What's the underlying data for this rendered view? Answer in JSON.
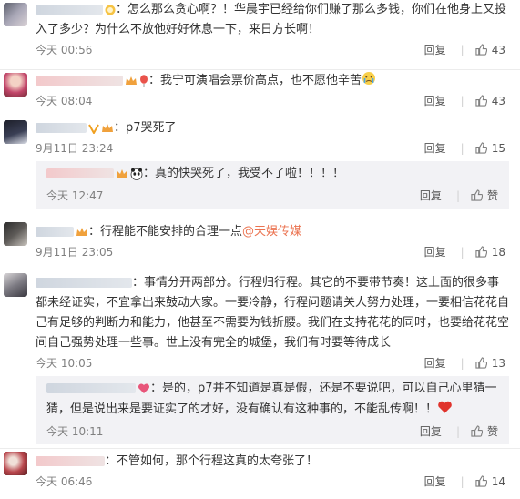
{
  "comments": [
    {
      "text": "：怎么那么贪心啊？！华晨宇已经给你们赚了那么多钱，你们在他身上又投入了多少？为什么不放他好好休息一下，来日方长啊！",
      "time": "今天 00:56",
      "reply": "回复",
      "likes": "43"
    },
    {
      "text": "：我宁可演唱会票价高点，也不愿他辛苦",
      "time": "今天 08:04",
      "reply": "回复",
      "likes": "43"
    },
    {
      "text": "：p7哭死了",
      "time": "9月11日 23:24",
      "reply": "回复",
      "likes": "15",
      "sub": {
        "text": "：真的快哭死了，我受不了啦！！！！",
        "time": "今天 12:47",
        "reply": "回复",
        "like": "赞"
      }
    },
    {
      "text": "：行程能不能安排的合理一点",
      "mention": "@天娱传媒",
      "time": "9月11日 23:05",
      "reply": "回复",
      "likes": "18"
    },
    {
      "text": "：事情分开两部分。行程归行程。其它的不要带节奏！这上面的很多事都未经证实，不宜拿出来鼓动大家。一要冷静，行程问题请关人努力处理，一要相信花花自己有足够的判断力和能力，他甚至不需要为钱折腰。我们在支持花花的同时，也要给花花空间自己强势处理一些事。世上没有完全的城堡，我们有时要等待成长",
      "time": "今天 10:05",
      "reply": "回复",
      "likes": "13",
      "sub": {
        "text": "：是的，p7并不知道是真是假，还是不要说吧，可以自己心里猜一猜，但是说出来是要证实了的才好，没有确认有这种事的，不能乱传啊！！",
        "time": "今天 10:11",
        "reply": "回复",
        "like": "赞"
      }
    },
    {
      "text": "：不管如何，那个行程这真的太夸张了！",
      "time": "今天 06:46",
      "reply": "回复",
      "likes": "14"
    }
  ]
}
